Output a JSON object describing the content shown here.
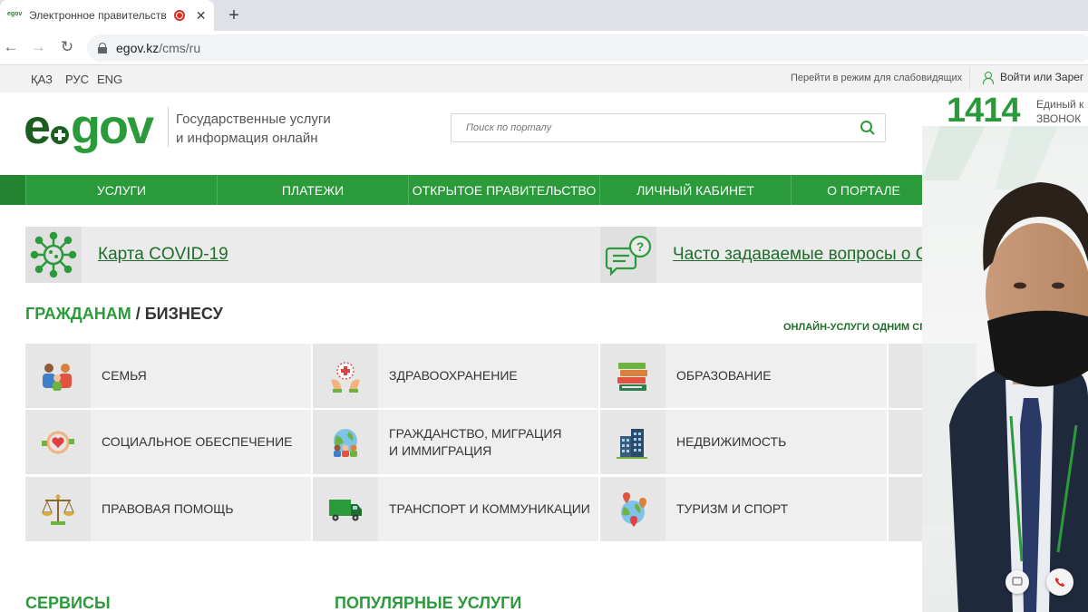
{
  "browser": {
    "tab_title": "Электронное правительств",
    "favicon_text": "egov",
    "url_domain": "egov.kz",
    "url_path": "/cms/ru"
  },
  "topbar": {
    "languages": [
      "ҚАЗ",
      "РУС",
      "ENG"
    ],
    "low_vision": "Перейти в режим для слабовидящих",
    "login": "Войти или Зарег"
  },
  "header": {
    "logo_e": "e",
    "logo_gov": "gov",
    "tagline_1": "Государственные услуги",
    "tagline_2": "и информация онлайн",
    "search_placeholder": "Поиск по порталу",
    "hotline_number": "1414",
    "hotline_text_1": "Единый к",
    "hotline_text_2": "ЗВОНОК Б"
  },
  "nav": [
    "УСЛУГИ",
    "ПЛАТЕЖИ",
    "ОТКРЫТОЕ ПРАВИТЕЛЬСТВО",
    "ЛИЧНЫЙ КАБИНЕТ",
    "О ПОРТАЛЕ"
  ],
  "banners": {
    "covid": "Карта COVID-19",
    "faq": "Часто задаваемые вопросы о COV"
  },
  "section": {
    "title_citizens": "ГРАЖДАНАМ",
    "title_sep": " / ",
    "title_business": "БИЗНЕСУ",
    "online_link": "ОНЛАЙН-УСЛУГИ ОДНИМ СПИС"
  },
  "categories": [
    {
      "label": "СЕМЬЯ",
      "icon": "family-icon"
    },
    {
      "label": "ЗДРАВООХРАНЕНИЕ",
      "icon": "healthcare-icon"
    },
    {
      "label": "ОБРАЗОВАНИЕ",
      "icon": "books-icon"
    },
    {
      "label": "СОЦИАЛЬНОЕ ОБЕСПЕЧЕНИЕ",
      "icon": "social-care-icon"
    },
    {
      "label": "ГРАЖДАНСТВО, МИГРАЦИЯ И ИММИГРАЦИЯ",
      "icon": "citizenship-icon"
    },
    {
      "label": "НЕДВИЖИМОСТЬ",
      "icon": "buildings-icon"
    },
    {
      "label": "ПРАВОВАЯ ПОМОЩЬ",
      "icon": "scales-icon"
    },
    {
      "label": "ТРАНСПОРТ И КОММУНИКАЦИИ",
      "icon": "truck-icon"
    },
    {
      "label": "ТУРИЗМ И СПОРТ",
      "icon": "globe-pin-icon"
    }
  ],
  "bottom": {
    "services": "СЕРВИСЫ",
    "popular": "ПОПУЛЯРНЫЕ УСЛУГИ"
  },
  "colors": {
    "brand_green": "#2b9a3a",
    "dark_green": "#1f6d2a",
    "end_call_red": "#d93025"
  }
}
